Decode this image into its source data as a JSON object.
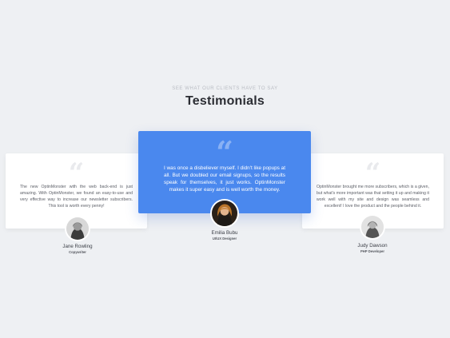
{
  "section": {
    "eyebrow": "SEE WHAT OUR CLIENTS HAVE TO SAY",
    "title": "Testimonials"
  },
  "colors": {
    "background": "#eef0f3",
    "card": "#ffffff",
    "active_card": "#4a88ee",
    "title": "#2b2d33"
  },
  "testimonials": [
    {
      "quote_icon": "quote-icon",
      "text": "The new OptinMonster with the web back-end is just amazing. With OptinMonster, we found an easy-to-use and very effective way to increase our newsletter subscribers. This tool is worth every penny!",
      "name": "Jane Rowling",
      "role": "Copywriter",
      "active": false
    },
    {
      "quote_icon": "quote-icon",
      "text": "I was once a disbeliever myself. I didn't like popups at all. But we doubled our email signups, so the results speak for themselves, it just works. OptinMonster makes it super easy and is well worth the money.",
      "name": "Emilia Bubu",
      "role": "UI/UX Designer",
      "active": true
    },
    {
      "quote_icon": "quote-icon",
      "text": "OptinMonster brought me more subscribers, which is a given, but what's more important was that setting it up and making it work well with my site and design was seamless and excellent! I love the product and the people behind it.",
      "name": "Judy Dawson",
      "role": "PHP Developer",
      "active": false
    }
  ]
}
